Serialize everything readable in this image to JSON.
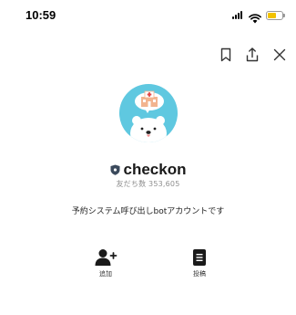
{
  "status_bar": {
    "time": "10:59"
  },
  "profile": {
    "name": "checkon",
    "friends_label": "友だち数",
    "friends_count": "353,605",
    "description": "予約システム呼び出しbotアカウントです"
  },
  "actions": [
    {
      "label": "追加",
      "icon": "add-friend-icon"
    },
    {
      "label": "投稿",
      "icon": "post-icon"
    }
  ],
  "toolbar": {
    "icons": [
      "bookmark-icon",
      "share-icon",
      "close-icon"
    ]
  },
  "colors": {
    "avatar_bg": "#5fc8e0",
    "battery": "#f2c200",
    "badge": "#3b4a5c"
  }
}
